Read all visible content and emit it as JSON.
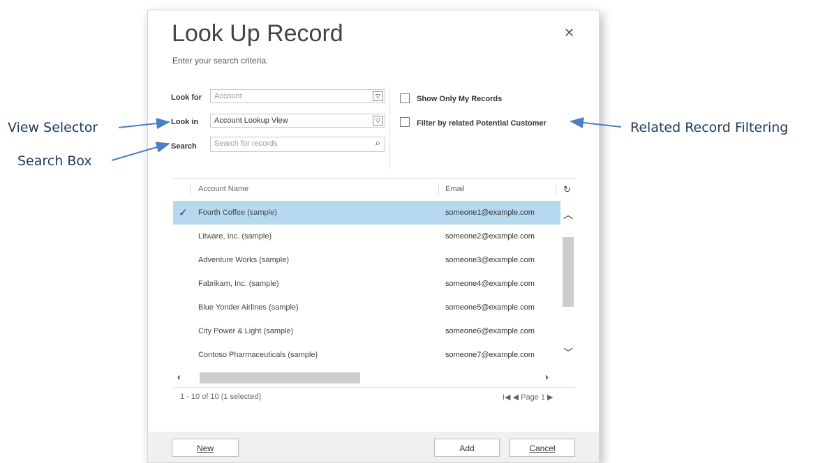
{
  "callouts": {
    "view_selector": "View Selector",
    "search_box": "Search Box",
    "related_filtering": "Related Record Filtering"
  },
  "dialog": {
    "title": "Look Up Record",
    "subtitle": "Enter your search criteria.",
    "close_icon": "close-icon",
    "look_for": {
      "label": "Look for",
      "value": "Account"
    },
    "look_in": {
      "label": "Look in",
      "value": "Account Lookup View"
    },
    "search": {
      "label": "Search",
      "placeholder": "Search for records"
    },
    "options": {
      "show_only_my_records": "Show Only My Records",
      "filter_related": "Filter by related Potential Customer"
    }
  },
  "grid": {
    "columns": [
      "Account Name",
      "Email"
    ],
    "rows": [
      {
        "name": "Fourth Coffee (sample)",
        "email": "someone1@example.com",
        "selected": true
      },
      {
        "name": "Litware, Inc. (sample)",
        "email": "someone2@example.com",
        "selected": false
      },
      {
        "name": "Adventure Works (sample)",
        "email": "someone3@example.com",
        "selected": false
      },
      {
        "name": "Fabrikam, Inc. (sample)",
        "email": "someone4@example.com",
        "selected": false
      },
      {
        "name": "Blue Yonder Airlines (sample)",
        "email": "someone5@example.com",
        "selected": false
      },
      {
        "name": "City Power & Light (sample)",
        "email": "someone6@example.com",
        "selected": false
      },
      {
        "name": "Contoso Pharmaceuticals (sample)",
        "email": "someone7@example.com",
        "selected": false
      }
    ],
    "status": "1 - 10 of 10 (1 selected)",
    "pager": {
      "first": "I◀",
      "prev": "◀",
      "page": "Page 1",
      "next": "▶"
    }
  },
  "buttons": {
    "new": "New",
    "add": "Add",
    "cancel": "Cancel"
  },
  "colors": {
    "selection": "#b7d9ef",
    "arrow": "#4a7fc1",
    "callout_text": "#1f3a5a"
  }
}
